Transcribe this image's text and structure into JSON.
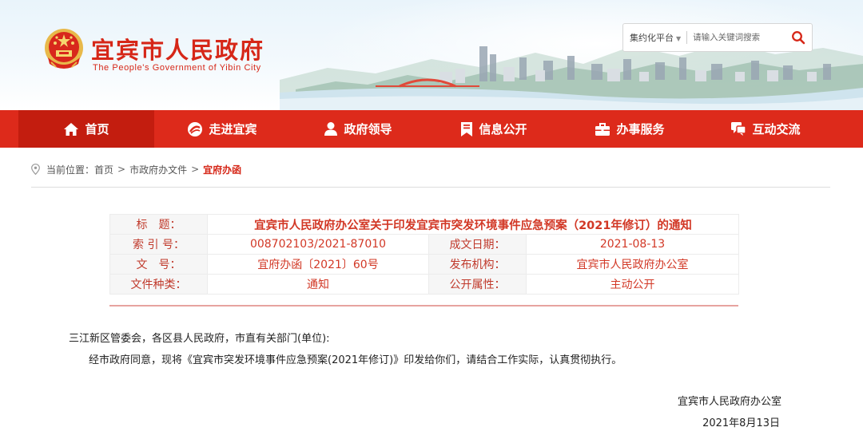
{
  "header": {
    "site_title": "宜宾市人民政府",
    "site_subtitle": "The People's Government of Yibin City",
    "search": {
      "scope": "集约化平台",
      "placeholder": "请输入关键词搜索",
      "icon": "search-icon"
    }
  },
  "nav": {
    "items": [
      {
        "label": "首页",
        "icon": "home-icon"
      },
      {
        "label": "走进宜宾",
        "icon": "compass-icon"
      },
      {
        "label": "政府领导",
        "icon": "person-icon"
      },
      {
        "label": "信息公开",
        "icon": "bookmark-icon"
      },
      {
        "label": "办事服务",
        "icon": "briefcase-icon"
      },
      {
        "label": "互动交流",
        "icon": "chat-icon"
      }
    ]
  },
  "breadcrumb": {
    "prefix": "当前位置：",
    "items": [
      "首页",
      "市政府办文件",
      "宜府办函"
    ],
    "separator": ">"
  },
  "info": {
    "title_label": "标　题：",
    "title_value": "宜宾市人民政府办公室关于印发宜宾市突发环境事件应急预案（2021年修订）的通知",
    "index_label": "索 引 号：",
    "index_value": "008702103/2021-87010",
    "date_label": "成文日期：",
    "date_value": "2021-08-13",
    "docno_label": "文　号：",
    "docno_value": "宜府办函〔2021〕60号",
    "issuer_label": "发布机构：",
    "issuer_value": "宜宾市人民政府办公室",
    "type_label": "文件种类：",
    "type_value": "通知",
    "open_label": "公开属性：",
    "open_value": "主动公开"
  },
  "article": {
    "addressees": "三江新区管委会，各区县人民政府，市直有关部门(单位):",
    "body": "经市政府同意，现将《宜宾市突发环境事件应急预案(2021年修订)》印发给你们，请结合工作实际，认真贯彻执行。",
    "signature": "宜宾市人民政府办公室",
    "date": "2021年8月13日"
  },
  "colors": {
    "brand_red": "#dd2a1b",
    "nav_active": "#c31d0f",
    "label_red": "#c0392b"
  }
}
